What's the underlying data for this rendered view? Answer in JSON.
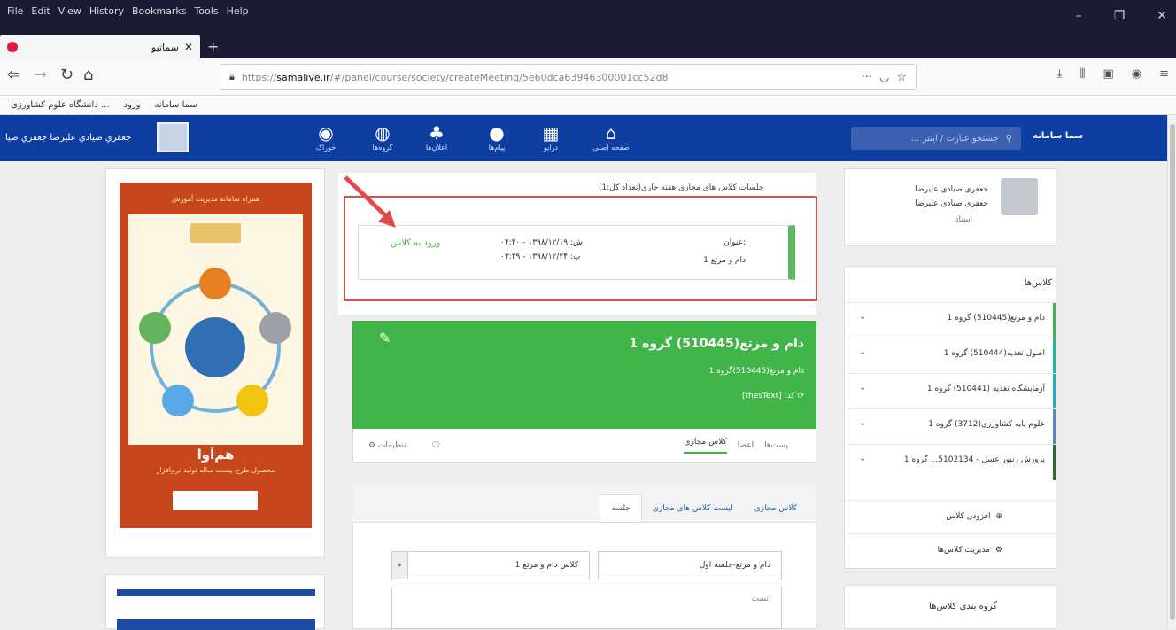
{
  "browser": {
    "menus": [
      "File",
      "Edit",
      "View",
      "History",
      "Bookmarks",
      "Tools",
      "Help"
    ],
    "tab_title": "سماتیو",
    "url_prefix": "https://",
    "url_host": "samalive.ir",
    "url_path": "/#/panel/course/society/createMeeting/5e60dca63946300001cc52d8",
    "bookmarks": [
      "سما سامانه",
      "ورود",
      "دانشگاه علوم کشاورزی ..."
    ]
  },
  "appnav": {
    "user_name": "جعفري صيادي عليرضا جعفري صيا",
    "items": [
      {
        "label": "خوراک",
        "glyph": "◉"
      },
      {
        "label": "گروه‌ها",
        "glyph": "◍"
      },
      {
        "label": "اعلان‌ها",
        "glyph": "♣"
      },
      {
        "label": "پیام‌ها",
        "glyph": "●"
      },
      {
        "label": "درایو",
        "glyph": "▦"
      },
      {
        "label": "صفحه اصلی",
        "glyph": "⌂"
      }
    ],
    "search_placeholder": "جستجو عبارت / اینتر ...",
    "logo": "سما سامانه"
  },
  "poster": {
    "header": "همراه سامانه مدیریت آموزش",
    "title": "هم‌آوا",
    "subtitle": "محصول طرح بیست ساله تولید نرم‌افزار"
  },
  "sessions": {
    "title": "جلسات کلاس های مجازی هفته جاری(تعداد کل:1)",
    "enter_label": "ورود به کلاس",
    "start": "ش: ۱۳۹۸/۱۲/۱۹ - ۰۴:۴۰",
    "end": "پ: ۱۳۹۸/۱۲/۲۴ - ۰۳:۳۹",
    "name_label": "عنوان:",
    "name_value": "دام و مرتع 1"
  },
  "course": {
    "title": "دام و مرتع(510445) گروه 1",
    "subtitle": "دام و مرتع(510445)گروه 1",
    "code": "کد: [thesText] ",
    "tabs": [
      "پست‌ها",
      "اعضا",
      "کلاس مجازی"
    ],
    "settings_label": "تنظیمات"
  },
  "panel": {
    "tabs": [
      "کلاس مجازی",
      "لیست کلاس های مجازی",
      "جلسه"
    ],
    "field1": "دام و مرتع-جلسه اول",
    "field2": "کلاس دام و مرتع 1",
    "textarea": "تست"
  },
  "profile": {
    "line1": "جعفري صيادي عليرضا",
    "line2": "جعفري صيادي عليرضا",
    "line3": "استاد"
  },
  "classes": {
    "title": "کلاس‌ها",
    "items": [
      {
        "label": "دام و مرتع(510445) گروه 1",
        "color": "#42b549"
      },
      {
        "label": "اصول تغذیه(510444) گروه 1",
        "color": "#2bb3a1"
      },
      {
        "label": "آزمایشگاه تغذیه (510441) گروه 1",
        "color": "#29a9c9"
      },
      {
        "label": "علوم پایه کشاورزی(3712) گروه 1",
        "color": "#5b86c5"
      },
      {
        "label": "پرورش زنبور عسل - 5102134... گروه 1",
        "color": "#2e6b2e"
      }
    ],
    "add_label": "افزودن کلاس",
    "manage_label": "مدیریت کلاس‌ها"
  },
  "groups": {
    "title": "گروه بندی کلاس‌ها"
  }
}
